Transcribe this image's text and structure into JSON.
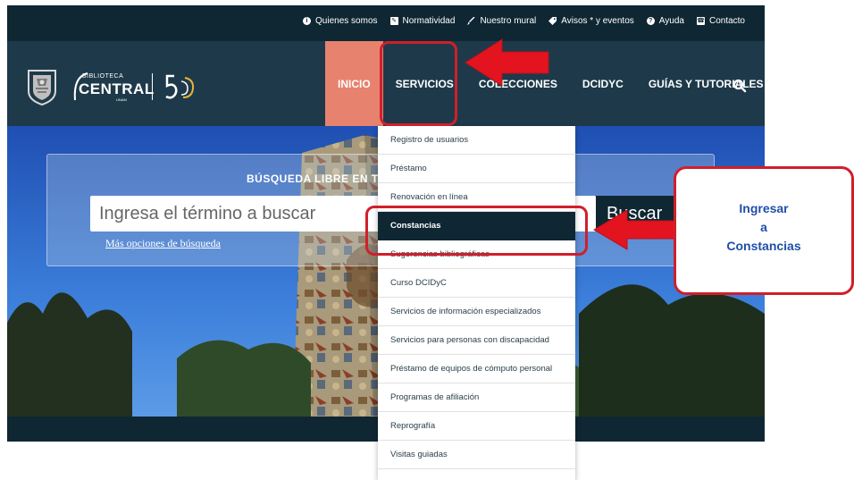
{
  "top_links": [
    {
      "label": "Quienes somos",
      "icon": "info-icon"
    },
    {
      "label": "Normatividad",
      "icon": "edit-icon"
    },
    {
      "label": "Nuestro mural",
      "icon": "brush-icon"
    },
    {
      "label": "Avisos * y eventos",
      "icon": "tag-icon"
    },
    {
      "label": "Ayuda",
      "icon": "help-icon"
    },
    {
      "label": "Contacto",
      "icon": "contact-icon"
    }
  ],
  "logo": {
    "small": "BIBLIOTECA",
    "big": "CENTRAL",
    "sub": "UNAM"
  },
  "nav": {
    "items": [
      {
        "label": "INICIO",
        "active": true
      },
      {
        "label": "SERVICIOS",
        "active": false
      },
      {
        "label": "COLECCIONES",
        "active": false
      },
      {
        "label": "DCIDYC",
        "active": false
      },
      {
        "label": "GUÍAS Y TUTORIALES",
        "active": false
      }
    ]
  },
  "search": {
    "title": "BÚSQUEDA LIBRE EN T",
    "placeholder": "Ingresa el término a buscar",
    "button": "Buscar",
    "more_link": "Más opciones de búsqueda"
  },
  "dropdown": {
    "items": [
      "Registro de usuarios",
      "Préstamo",
      "Renovación en línea",
      "Constancias",
      "Sugerencias bibliográficas",
      "Curso DCIDyC",
      "Servicios de información especializados",
      "Servicios para personas con discapacidad",
      "Préstamo de equipos de cómputo personal",
      "Programas de afiliación",
      "Reprografía",
      "Visitas guiadas"
    ],
    "selected_index": 3
  },
  "callout": {
    "lines": [
      "Ingresar",
      "a",
      "Constancias"
    ]
  },
  "colors": {
    "dark": "#0f2733",
    "nav": "#1e3a4a",
    "active": "#e7826e",
    "annotation": "#d01f2b",
    "callout_text": "#1f4fa8"
  }
}
